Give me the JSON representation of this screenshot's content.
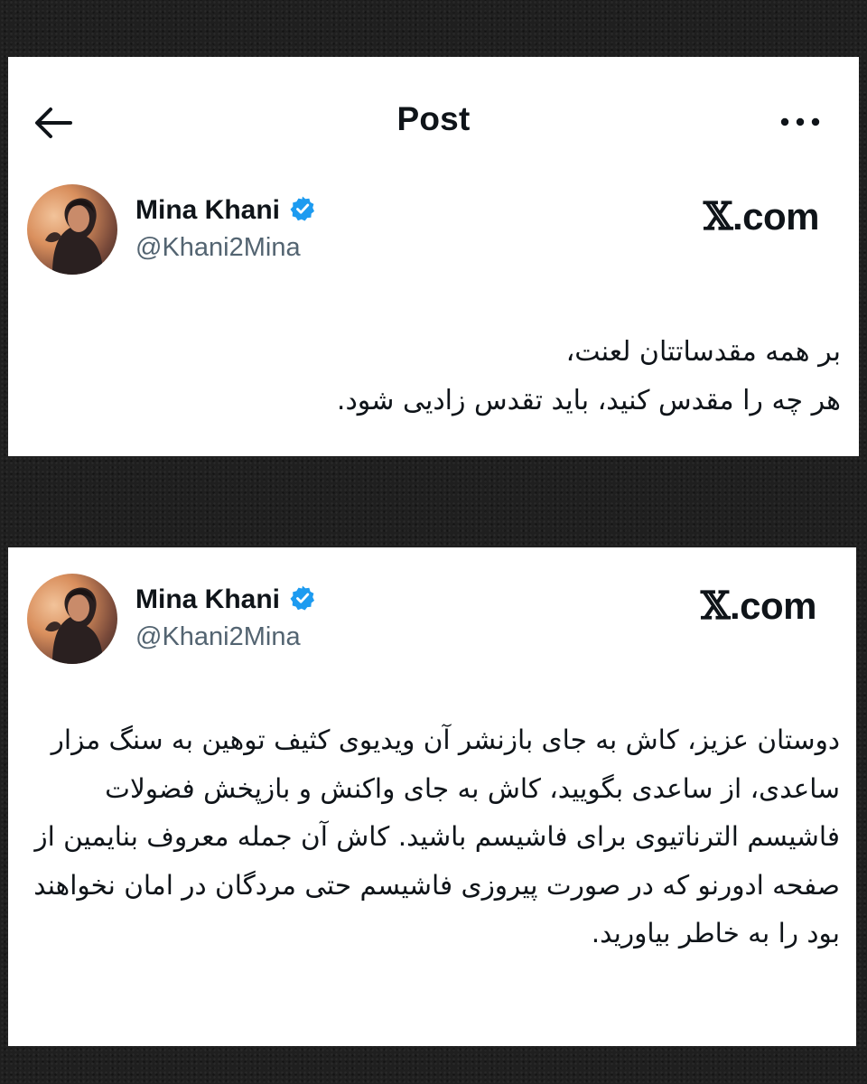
{
  "header": {
    "title": "Post",
    "back_icon": "arrow-left-icon",
    "more_icon": "more-horizontal-icon"
  },
  "posts": [
    {
      "author": {
        "name": "Mina Khani",
        "handle": "@Khani2Mina",
        "verified": true
      },
      "brand": ".com",
      "text": "بر همه مقدساتتان لعنت،\nهر چه را مقدس کنید، باید تقدس زادیی شود."
    },
    {
      "author": {
        "name": "Mina Khani",
        "handle": "@Khani2Mina",
        "verified": true
      },
      "brand": ".com",
      "text": "دوستان عزیز، کاش به جای بازنشر آن ویدیوی کثیف توهین به سنگ مزار ساعدی، از ساعدی بگویید، کاش به جای واکنش و بازپخش فضولات فاشیسم الترناتیوی برای فاشیسم باشید. کاش آن جمله معروف بنایمین از صفحه ادورنو که در صورت پیروزی فاشیسم حتی مردگان در امان نخواهند بود را به خاطر بیاورید."
    }
  ],
  "colors": {
    "verified": "#1d9bf0",
    "handle": "#536471",
    "text": "#0f1419",
    "background": "#1f1f1f"
  }
}
